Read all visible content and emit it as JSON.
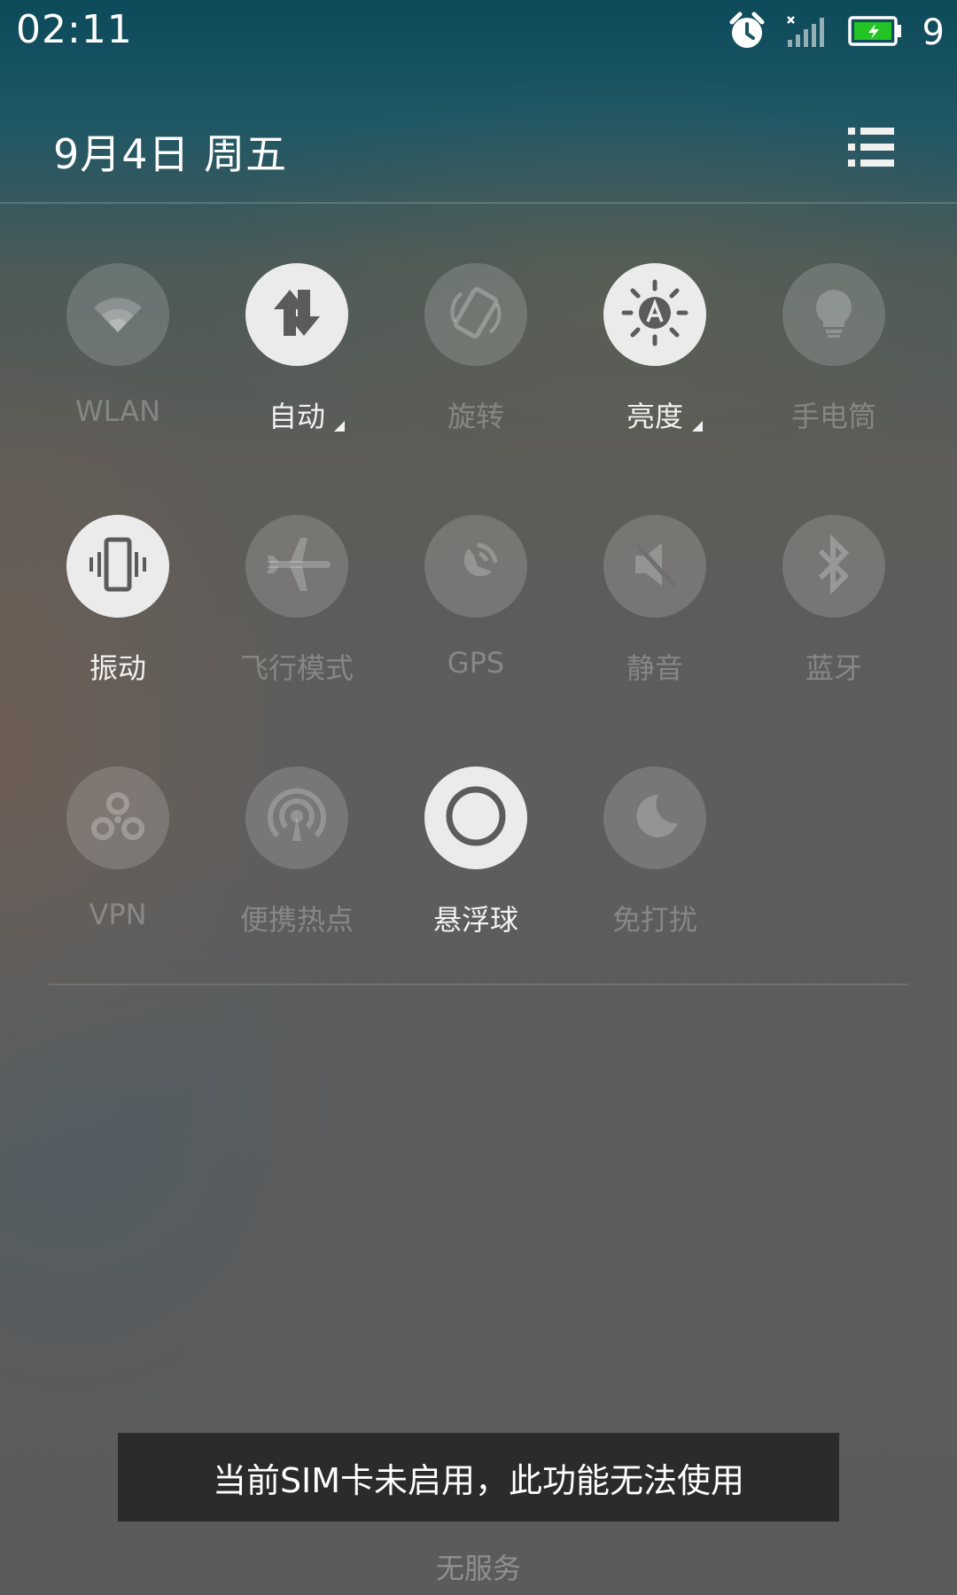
{
  "status_bar": {
    "time": "02:11",
    "battery_level": "9",
    "icons": [
      "alarm-icon",
      "signal-no-service-icon",
      "battery-charging-icon"
    ],
    "battery_color": "#22c322"
  },
  "header": {
    "date": "9月4日  周五",
    "list_icon": "list-icon"
  },
  "toggles": [
    {
      "label": "WLAN",
      "icon": "wifi-icon",
      "state": "off"
    },
    {
      "label": "自动",
      "icon": "data-transfer-icon",
      "state": "on"
    },
    {
      "label": "旋转",
      "icon": "rotate-icon",
      "state": "off"
    },
    {
      "label": "亮度",
      "icon": "brightness-auto-icon",
      "state": "on"
    },
    {
      "label": "手电筒",
      "icon": "flashlight-icon",
      "state": "off"
    },
    {
      "label": "振动",
      "icon": "vibrate-icon",
      "state": "on"
    },
    {
      "label": "飞行模式",
      "icon": "airplane-icon",
      "state": "off"
    },
    {
      "label": "GPS",
      "icon": "gps-icon",
      "state": "off"
    },
    {
      "label": "静音",
      "icon": "mute-icon",
      "state": "off"
    },
    {
      "label": "蓝牙",
      "icon": "bluetooth-icon",
      "state": "off"
    },
    {
      "label": "VPN",
      "icon": "vpn-icon",
      "state": "off"
    },
    {
      "label": "便携热点",
      "icon": "hotspot-icon",
      "state": "off"
    },
    {
      "label": "悬浮球",
      "icon": "floating-ball-icon",
      "state": "on"
    },
    {
      "label": "免打扰",
      "icon": "do-not-disturb-icon",
      "state": "off"
    }
  ],
  "toast": {
    "message": "当前SIM卡未启用，此功能无法使用"
  },
  "footer": {
    "service_status": "无服务"
  }
}
